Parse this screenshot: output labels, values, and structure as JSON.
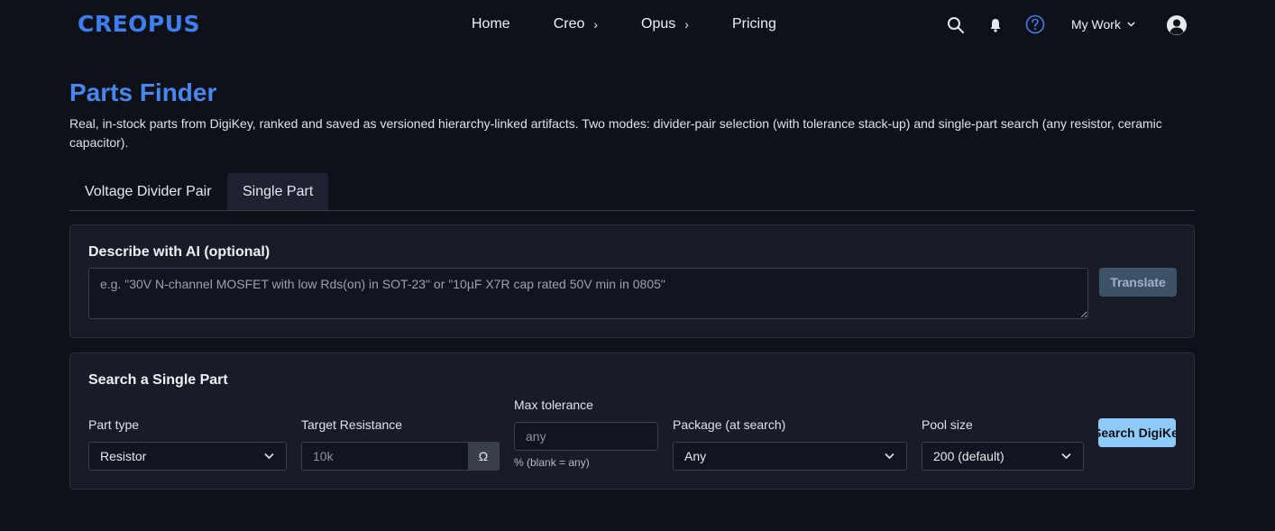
{
  "nav": {
    "logo": "CREOPUS",
    "links": [
      {
        "label": "Home",
        "has_chevron": false
      },
      {
        "label": "Creo",
        "has_chevron": true
      },
      {
        "label": "Opus",
        "has_chevron": true
      },
      {
        "label": "Pricing",
        "has_chevron": false
      }
    ],
    "chevron_glyph": "›",
    "my_work": "My Work",
    "icons": [
      "search-icon",
      "bell-icon",
      "help-icon",
      "user-avatar-icon"
    ]
  },
  "page": {
    "title": "Parts Finder",
    "description": "Real, in-stock parts from DigiKey, ranked and saved as versioned hierarchy-linked artifacts. Two modes: divider-pair selection (with tolerance stack-up) and single-part search (any resistor, ceramic capacitor)."
  },
  "tabs": [
    {
      "label": "Voltage Divider Pair",
      "active": false
    },
    {
      "label": "Single Part",
      "active": true
    }
  ],
  "ai": {
    "title": "Describe with AI (optional)",
    "placeholder": "e.g. \"30V N-channel MOSFET with low Rds(on) in SOT-23\" or \"10µF X7R cap rated 50V min in 0805\"",
    "value": "",
    "translate_label": "Translate"
  },
  "search": {
    "title": "Search a Single Part",
    "part_type": {
      "label": "Part type",
      "value": "Resistor"
    },
    "target": {
      "label": "Target Resistance",
      "placeholder": "10k",
      "unit": "Ω"
    },
    "tolerance": {
      "label": "Max tolerance",
      "placeholder": "any",
      "hint": "% (blank = any)"
    },
    "package": {
      "label": "Package (at search)",
      "value": "Any"
    },
    "pool": {
      "label": "Pool size",
      "value": "200 (default)"
    },
    "button_label": "Search DigiKey"
  },
  "colors": {
    "background": "#0f1118",
    "accent": "#4a86f0",
    "card": "#181c27",
    "primary_button": "#8ecbf8",
    "disabled_button": "#3d5266"
  }
}
